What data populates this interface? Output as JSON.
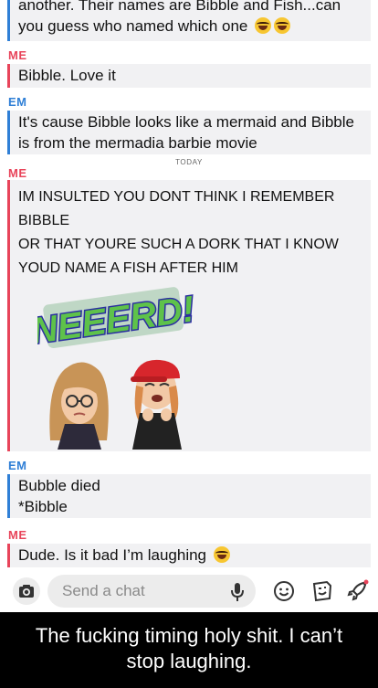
{
  "messages": {
    "top_line1": "another. Their names are Bibble and Fish...can",
    "top_line2": "you guess who named which one",
    "sender_me_1": "ME",
    "msg_bibble": "Bibble. Love it",
    "sender_em_1": "EM",
    "msg_mermaid_1": "It's cause Bibble looks like a mermaid and Bibble",
    "msg_mermaid_2": "is from the mermadia barbie movie",
    "date_divider": "TODAY",
    "sender_me_2": "ME",
    "big_line1": "IM INSULTED YOU DONT THINK I REMEMBER",
    "big_line2": "BIBBLE",
    "big_line3": "OR THAT YOURE SUCH A DORK THAT I KNOW",
    "big_line4": "YOUD NAME A FISH AFTER HIM",
    "sticker_text": "NEEERD!",
    "sender_em_2": "EM",
    "msg_bubble_died": "Bubble died",
    "msg_star_bibble": "*Bibble",
    "sender_me_3": "ME",
    "msg_dude": "Dude. Is it bad I’m laughing"
  },
  "composer": {
    "placeholder": "Send a chat"
  },
  "caption": {
    "line1": "The fucking timing holy shit. I can’t",
    "line2": "stop laughing."
  },
  "colors": {
    "me": "#e8445a",
    "em": "#2f7fd6",
    "bubble_bg": "#f1f1f3"
  },
  "icons": [
    "camera-icon",
    "microphone-icon",
    "smiley-icon",
    "sticker-icon",
    "rocket-icon",
    "laughing-emoji-icon"
  ]
}
